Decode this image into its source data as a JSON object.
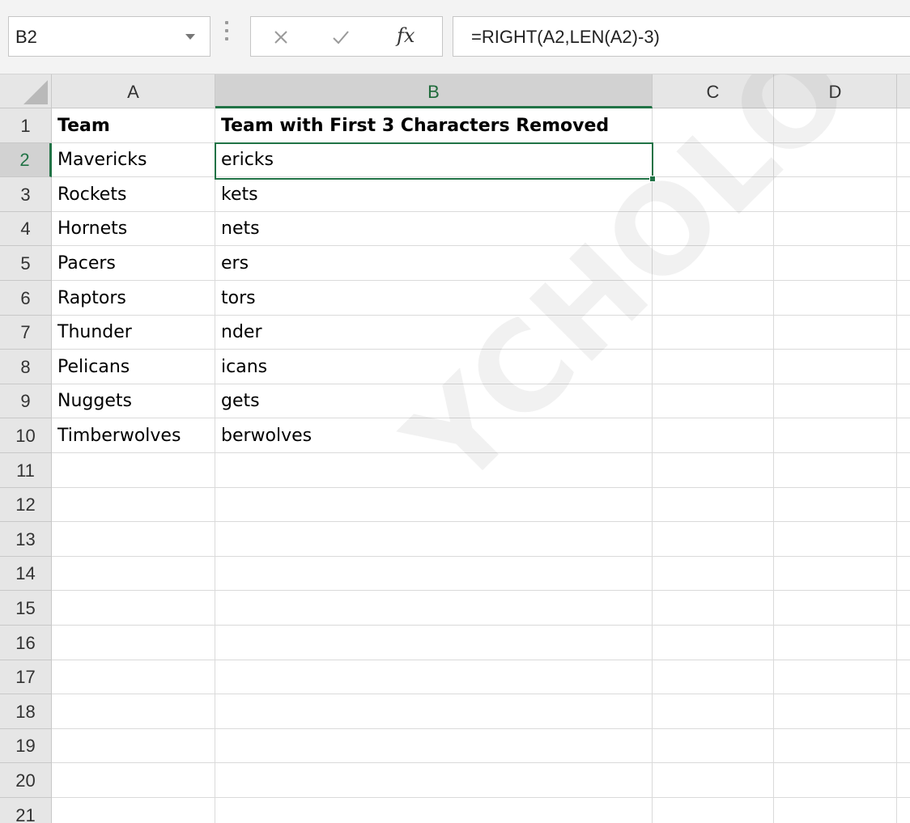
{
  "formula_bar": {
    "name_box": "B2",
    "cancel_icon": "close-icon",
    "enter_icon": "check-icon",
    "fx_label": "fx",
    "formula": "=RIGHT(A2,LEN(A2)-3)"
  },
  "columns": [
    "A",
    "B",
    "C",
    "D"
  ],
  "selected_cell": "B2",
  "rows": [
    {
      "num": "1",
      "a": "Team",
      "b": "Team with First 3 Characters Removed"
    },
    {
      "num": "2",
      "a": "Mavericks",
      "b": "ericks"
    },
    {
      "num": "3",
      "a": "Rockets",
      "b": "kets"
    },
    {
      "num": "4",
      "a": "Hornets",
      "b": "nets"
    },
    {
      "num": "5",
      "a": "Pacers",
      "b": "ers"
    },
    {
      "num": "6",
      "a": "Raptors",
      "b": "tors"
    },
    {
      "num": "7",
      "a": "Thunder",
      "b": "nder"
    },
    {
      "num": "8",
      "a": "Pelicans",
      "b": "icans"
    },
    {
      "num": "9",
      "a": "Nuggets",
      "b": "gets"
    },
    {
      "num": "10",
      "a": "Timberwolves",
      "b": "berwolves"
    },
    {
      "num": "11",
      "a": "",
      "b": ""
    },
    {
      "num": "12",
      "a": "",
      "b": ""
    },
    {
      "num": "13",
      "a": "",
      "b": ""
    },
    {
      "num": "14",
      "a": "",
      "b": ""
    },
    {
      "num": "15",
      "a": "",
      "b": ""
    },
    {
      "num": "16",
      "a": "",
      "b": ""
    },
    {
      "num": "17",
      "a": "",
      "b": ""
    },
    {
      "num": "18",
      "a": "",
      "b": ""
    },
    {
      "num": "19",
      "a": "",
      "b": ""
    },
    {
      "num": "20",
      "a": "",
      "b": ""
    },
    {
      "num": "21",
      "a": "",
      "b": ""
    }
  ],
  "watermark": "YCHOLOGY.CO",
  "colors": {
    "accent": "#217346",
    "header_bg": "#e6e6e6",
    "selected_header_bg": "#d2d2d2"
  }
}
